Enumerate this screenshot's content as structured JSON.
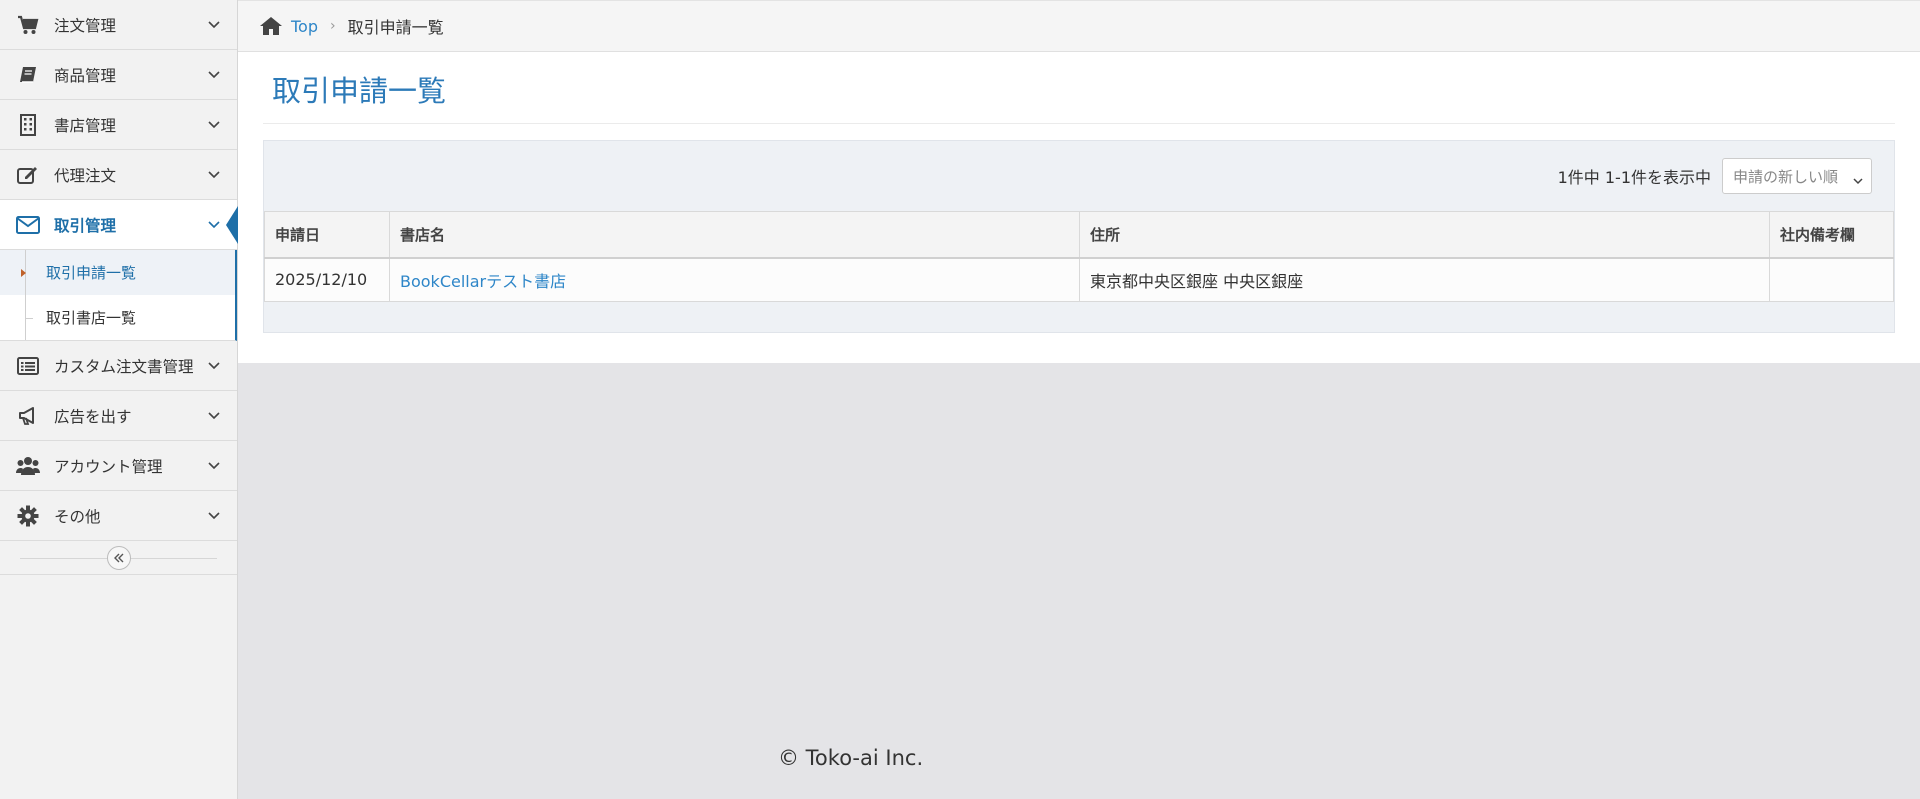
{
  "sidebar": {
    "items": [
      {
        "label": "注文管理",
        "icon": "cart-icon"
      },
      {
        "label": "商品管理",
        "icon": "book-icon"
      },
      {
        "label": "書店管理",
        "icon": "building-icon"
      },
      {
        "label": "代理注文",
        "icon": "edit-icon"
      },
      {
        "label": "取引管理",
        "icon": "envelope-icon",
        "active": true,
        "subitems": [
          {
            "label": "取引申請一覧",
            "active": true
          },
          {
            "label": "取引書店一覧"
          }
        ]
      },
      {
        "label": "カスタム注文書管理",
        "icon": "list-icon"
      },
      {
        "label": "広告を出す",
        "icon": "megaphone-icon"
      },
      {
        "label": "アカウント管理",
        "icon": "users-icon"
      },
      {
        "label": "その他",
        "icon": "gear-icon"
      }
    ],
    "collapse_icon": "double-chevron-left-icon"
  },
  "breadcrumb": {
    "home_label": "Top",
    "current": "取引申請一覧"
  },
  "page": {
    "title": "取引申請一覧",
    "count_text": "1件中 1-1件を表示中",
    "sort_selected": "申請の新しい順"
  },
  "table": {
    "headers": [
      "申請日",
      "書店名",
      "住所",
      "社内備考欄"
    ],
    "rows": [
      [
        "2025/12/10",
        "BookCellarテスト書店",
        "東京都中央区銀座 中央区銀座",
        ""
      ]
    ]
  },
  "footer": {
    "copyright": "© Toko-ai Inc."
  },
  "colors": {
    "accent": "#1e6fa8",
    "link": "#2e86c8",
    "title": "#2c7ab8"
  }
}
